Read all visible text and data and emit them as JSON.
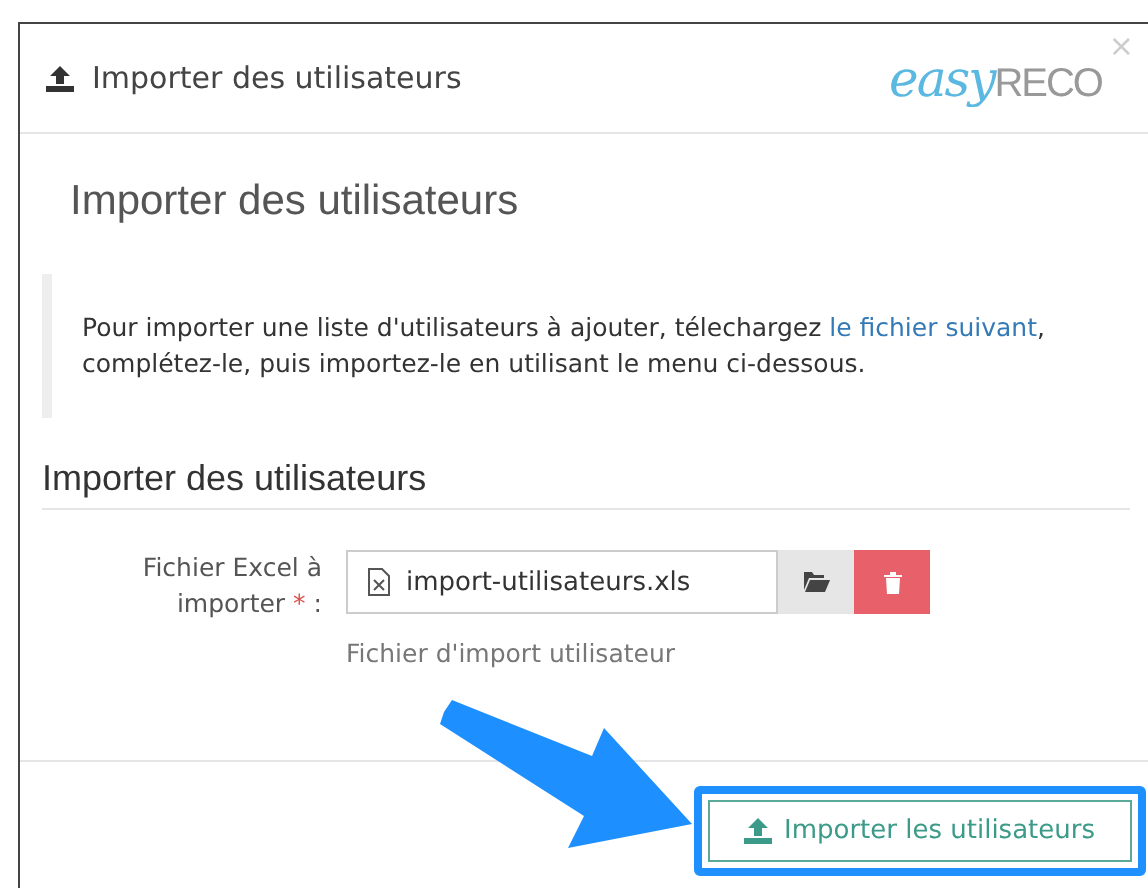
{
  "header": {
    "title": "Importer des utilisateurs",
    "logo_main": "easy",
    "logo_sub": "RECO",
    "close": "×"
  },
  "page_title": "Importer des utilisateurs",
  "info": {
    "before": "Pour importer une liste d'utilisateurs à ajouter, télechargez ",
    "link": "le fichier suivant",
    "after": ", complétez-le, puis importez-le en utilisant le menu ci-dessous."
  },
  "section_title": "Importer des utilisateurs",
  "field": {
    "label": "Fichier Excel à importer",
    "required": "*",
    "colon": ":",
    "value": "import-utilisateurs.xls",
    "help": "Fichier d'import utilisateur"
  },
  "submit": {
    "label": "Importer les utilisateurs",
    "highlighted": true
  }
}
